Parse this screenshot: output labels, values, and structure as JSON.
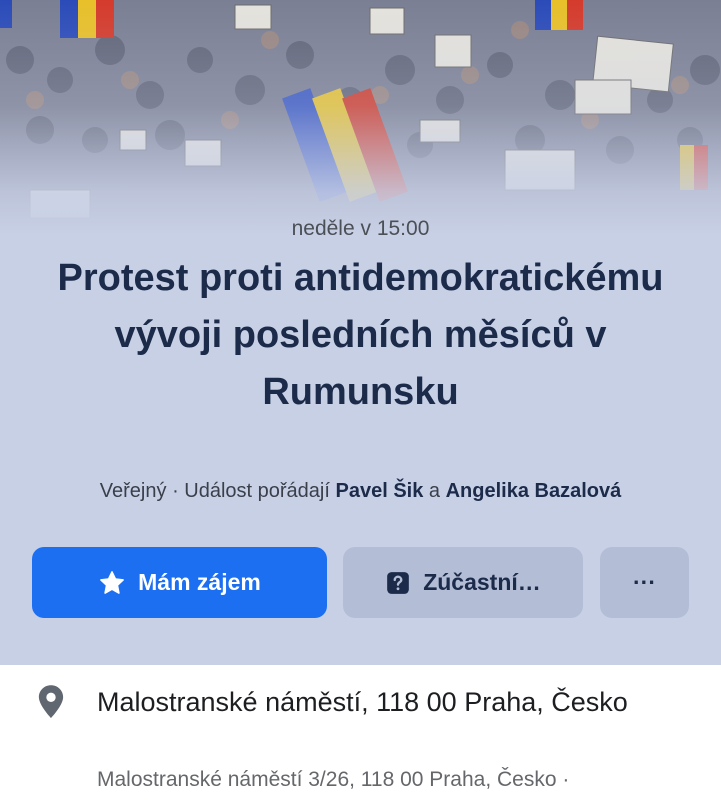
{
  "event": {
    "time": "neděle v 15:00",
    "title": "Protest proti antidemokratickému vývoji posledních měsíců v Rumunsku",
    "privacy": "Veřejný",
    "organized_by_prefix": "Událost pořádají",
    "organizer_1": "Pavel Šik",
    "organizer_conj": "a",
    "organizer_2": "Angelika Bazalová"
  },
  "actions": {
    "interested_label": "Mám zájem",
    "going_label": "Zúčastní…",
    "more_label": "···"
  },
  "location": {
    "name": "Malostranské náměstí, 118 00 Praha, Česko",
    "address": "Malostranské náměstí 3/26, 118 00 Praha, Česko ·"
  },
  "icons": {
    "interested": "star-icon",
    "going": "question-icon",
    "location": "map-pin-icon"
  },
  "colors": {
    "hero_background": "#c8d0e6",
    "primary_button": "#1b6ff0",
    "secondary_button": "#b3bed6",
    "title_text": "#1c2b4a"
  }
}
